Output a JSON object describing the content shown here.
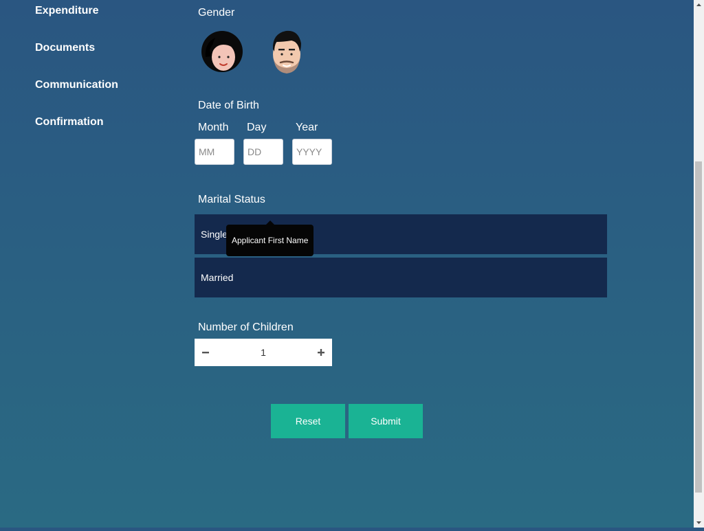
{
  "sidebar": {
    "items": [
      {
        "label": "Expenditure"
      },
      {
        "label": "Documents"
      },
      {
        "label": "Communication"
      },
      {
        "label": "Confirmation"
      }
    ]
  },
  "gender": {
    "label": "Gender",
    "options": [
      "female-avatar-icon",
      "male-avatar-icon"
    ]
  },
  "dob": {
    "label": "Date of Birth",
    "month": {
      "label": "Month",
      "placeholder": "MM",
      "value": ""
    },
    "day": {
      "label": "Day",
      "placeholder": "DD",
      "value": ""
    },
    "year": {
      "label": "Year",
      "placeholder": "YYYY",
      "value": ""
    }
  },
  "marital": {
    "label": "Marital Status",
    "options": [
      {
        "label": "Single"
      },
      {
        "label": "Married"
      }
    ]
  },
  "tooltip": {
    "text": "Applicant First Name"
  },
  "children": {
    "label": "Number of Children",
    "value": "1",
    "minus_icon": "minus-icon",
    "plus_icon": "plus-icon"
  },
  "actions": {
    "reset_label": "Reset",
    "submit_label": "Submit"
  },
  "colors": {
    "background_top": "#2a5681",
    "background_bottom": "#2a6a83",
    "option_bg": "#14294d",
    "button_bg": "#1ab394",
    "tooltip_bg": "#050505"
  }
}
